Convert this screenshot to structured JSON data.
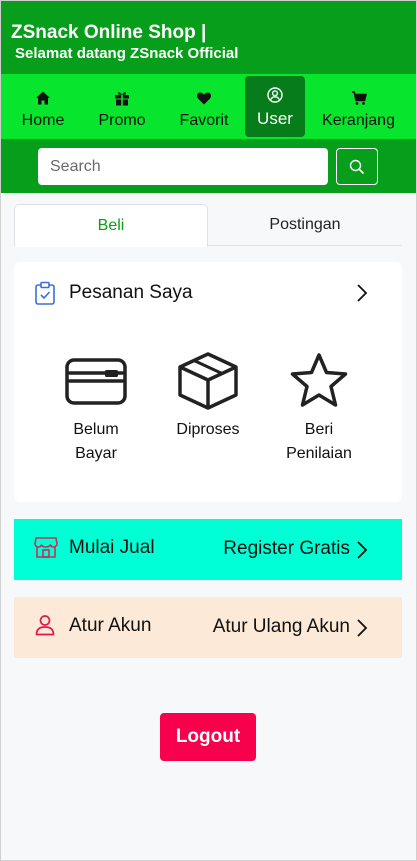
{
  "header": {
    "title": "ZSnack Online Shop |",
    "subtitle": "Selamat datang ZSnack Official"
  },
  "nav": {
    "items": [
      {
        "label": "Home",
        "icon": "home-icon"
      },
      {
        "label": "Promo",
        "icon": "gift-icon"
      },
      {
        "label": "Favorit",
        "icon": "heart-icon"
      },
      {
        "label": "User",
        "icon": "user-circle-icon",
        "active": true
      },
      {
        "label": "Keranjang",
        "icon": "cart-icon"
      }
    ]
  },
  "search": {
    "placeholder": "Search",
    "value": ""
  },
  "tabs": [
    {
      "label": "Beli",
      "active": true
    },
    {
      "label": "Postingan",
      "active": false
    }
  ],
  "orders": {
    "title": "Pesanan Saya",
    "statuses": [
      {
        "label_line1": "Belum",
        "label_line2": "Bayar",
        "icon": "credit-card-icon"
      },
      {
        "label_line1": "Diproses",
        "label_line2": "",
        "icon": "box-icon"
      },
      {
        "label_line1": "Beri",
        "label_line2": "Penilaian",
        "icon": "star-icon"
      }
    ]
  },
  "sell": {
    "title": "Mulai Jual",
    "action": "Register Gratis",
    "icon": "shop-icon"
  },
  "account": {
    "title": "Atur Akun",
    "action": "Atur Ulang Akun",
    "icon": "person-icon"
  },
  "logout_label": "Logout",
  "colors": {
    "header_green": "#079e1c",
    "nav_green": "#07e52c",
    "active_nav": "#067d1a",
    "sell_bg": "#00ffd5",
    "account_bg": "#fde9d7",
    "logout_bg": "#f7004c"
  }
}
